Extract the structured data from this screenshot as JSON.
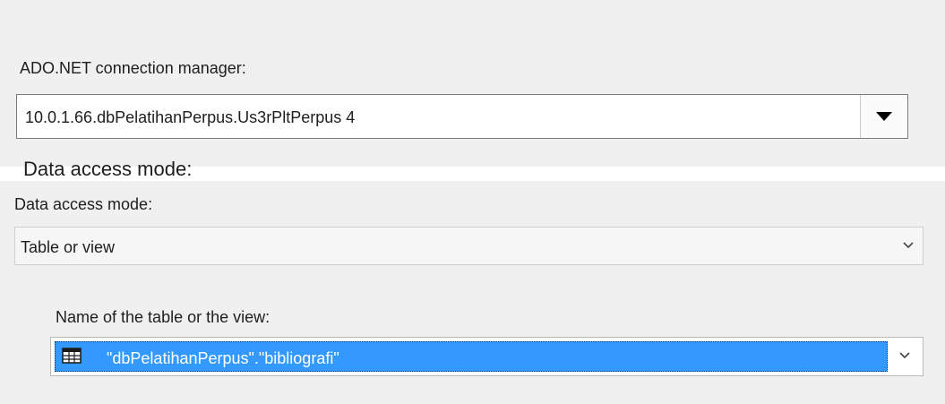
{
  "connection_manager": {
    "label": "ADO.NET connection manager:",
    "value": "10.0.1.66.dbPelatihanPerpus.Us3rPltPerpus 4",
    "dropdown_icon": "triangle-down-icon"
  },
  "clipped_label": "Data access mode:",
  "data_access_mode": {
    "label": "Data access mode:",
    "value": "Table or view",
    "dropdown_icon": "chevron-down-icon"
  },
  "table_name": {
    "label": "Name of the table or the view:",
    "value": "\"dbPelatihanPerpus\".\"bibliografi\"",
    "item_icon": "table-icon",
    "dropdown_icon": "chevron-down-icon"
  },
  "colors": {
    "panel_background": "#f0f0f0",
    "selection_highlight": "#3399ff",
    "selection_text": "#ffffff"
  }
}
